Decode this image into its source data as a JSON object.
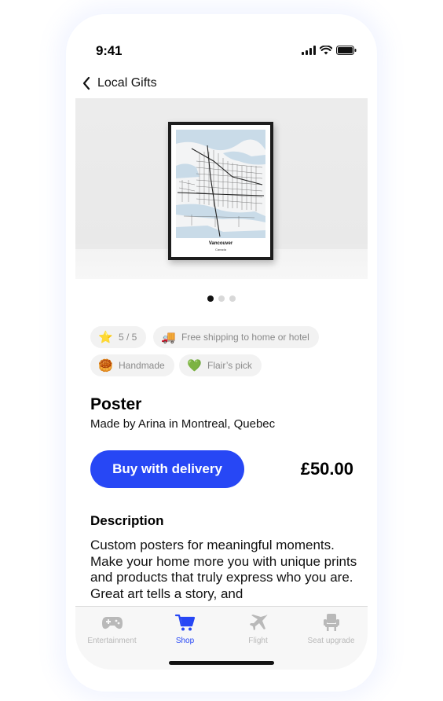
{
  "status_bar": {
    "time": "9:41",
    "icons": [
      "signal-icon",
      "wifi-icon",
      "battery-icon"
    ]
  },
  "nav": {
    "back_label": "Local Gifts",
    "back_icon": "chevron-left-icon"
  },
  "hero": {
    "poster_title": "Vancouver",
    "poster_subtitle": "Canada",
    "carousel_pages": 3,
    "carousel_active": 1
  },
  "chips": [
    {
      "icon": "⭐",
      "icon_name": "star-icon",
      "label": "5 / 5"
    },
    {
      "icon": "🚚",
      "icon_name": "truck-icon",
      "label": "Free shipping to home or hotel"
    },
    {
      "icon": "🥮",
      "icon_name": "handmade-icon",
      "label": "Handmade"
    },
    {
      "icon": "💚",
      "icon_name": "green-heart-icon",
      "label": "Flair’s pick"
    }
  ],
  "product": {
    "title": "Poster",
    "maker": "Made by Arina in Montreal, Quebec",
    "buy_label": "Buy with delivery",
    "price": "£50.00"
  },
  "description": {
    "heading": "Description",
    "text": "Custom posters for meaningful moments. Make your home more you with unique prints and products that truly express who you are. Great art tells a story, and"
  },
  "tab_bar": {
    "tabs": [
      {
        "label": "Entertainment",
        "icon_name": "gamepad-icon",
        "active": false
      },
      {
        "label": "Shop",
        "icon_name": "cart-icon",
        "active": true
      },
      {
        "label": "Flight",
        "icon_name": "airplane-icon",
        "active": false
      },
      {
        "label": "Seat upgrade",
        "icon_name": "seat-icon",
        "active": false
      }
    ]
  },
  "colors": {
    "accent": "#2747f5",
    "chip_bg": "#f2f2f2",
    "chip_text": "#8a8a8a",
    "tab_inactive": "#b9b9b9"
  }
}
